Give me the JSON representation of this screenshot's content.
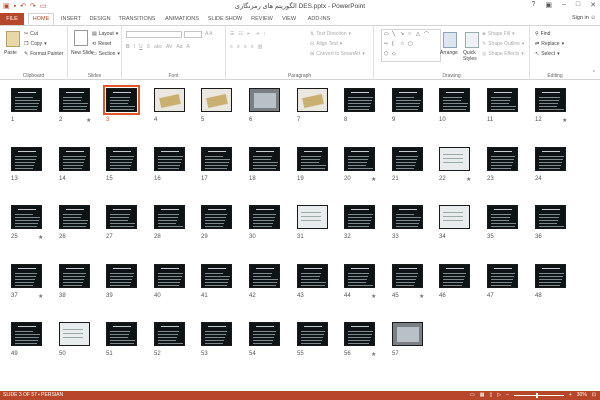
{
  "window": {
    "title": "DES.pptx - PowerPoint",
    "title_rtl": "الگوریتم های رمزنگاری",
    "signin": "Sign in"
  },
  "tabs": [
    "FILE",
    "HOME",
    "INSERT",
    "DESIGN",
    "TRANSITIONS",
    "ANIMATIONS",
    "SLIDE SHOW",
    "REVIEW",
    "VIEW",
    "ADD-INS"
  ],
  "ribbon": {
    "clipboard": {
      "paste": "Paste",
      "cut": "Cut",
      "copy": "Copy",
      "format_painter": "Format Painter",
      "label": "Clipboard"
    },
    "slides": {
      "new_slide": "New Slide",
      "layout": "Layout",
      "reset": "Reset",
      "section": "Section",
      "label": "Slides"
    },
    "font": {
      "label": "Font"
    },
    "paragraph": {
      "text_direction": "Text Direction",
      "align_text": "Align Text",
      "convert_smartart": "Convert to SmartArt",
      "label": "Paragraph"
    },
    "drawing": {
      "arrange": "Arrange",
      "quick_styles": "Quick Styles",
      "shape_fill": "Shape Fill",
      "shape_outline": "Shape Outline",
      "shape_effects": "Shape Effects",
      "label": "Drawing"
    },
    "editing": {
      "find": "Find",
      "replace": "Replace",
      "select": "Select",
      "label": "Editing"
    }
  },
  "slides": [
    {
      "n": "1",
      "star": false,
      "kind": "title"
    },
    {
      "n": "2",
      "star": true,
      "kind": "dark"
    },
    {
      "n": "3",
      "star": false,
      "kind": "dark",
      "selected": true
    },
    {
      "n": "4",
      "star": false,
      "kind": "diagram"
    },
    {
      "n": "5",
      "star": false,
      "kind": "diagram2"
    },
    {
      "n": "6",
      "star": false,
      "kind": "photo"
    },
    {
      "n": "7",
      "star": false,
      "kind": "diagram3"
    },
    {
      "n": "8",
      "star": false,
      "kind": "dark"
    },
    {
      "n": "9",
      "star": false,
      "kind": "dark"
    },
    {
      "n": "10",
      "star": false,
      "kind": "dark"
    },
    {
      "n": "11",
      "star": false,
      "kind": "dark"
    },
    {
      "n": "12",
      "star": true,
      "kind": "dark"
    },
    {
      "n": "13",
      "star": false,
      "kind": "dark"
    },
    {
      "n": "14",
      "star": false,
      "kind": "dark"
    },
    {
      "n": "15",
      "star": false,
      "kind": "dark"
    },
    {
      "n": "16",
      "star": false,
      "kind": "dark"
    },
    {
      "n": "17",
      "star": false,
      "kind": "dark"
    },
    {
      "n": "18",
      "star": false,
      "kind": "dark"
    },
    {
      "n": "19",
      "star": false,
      "kind": "dark"
    },
    {
      "n": "20",
      "star": true,
      "kind": "dark"
    },
    {
      "n": "21",
      "star": false,
      "kind": "dark"
    },
    {
      "n": "22",
      "star": true,
      "kind": "light"
    },
    {
      "n": "23",
      "star": false,
      "kind": "dark"
    },
    {
      "n": "24",
      "star": false,
      "kind": "dark"
    },
    {
      "n": "25",
      "star": true,
      "kind": "dark"
    },
    {
      "n": "26",
      "star": false,
      "kind": "dark"
    },
    {
      "n": "27",
      "star": false,
      "kind": "dark"
    },
    {
      "n": "28",
      "star": false,
      "kind": "dark"
    },
    {
      "n": "29",
      "star": false,
      "kind": "dark"
    },
    {
      "n": "30",
      "star": false,
      "kind": "dark"
    },
    {
      "n": "31",
      "star": false,
      "kind": "light"
    },
    {
      "n": "32",
      "star": false,
      "kind": "dark"
    },
    {
      "n": "33",
      "star": false,
      "kind": "dark"
    },
    {
      "n": "34",
      "star": false,
      "kind": "light"
    },
    {
      "n": "35",
      "star": false,
      "kind": "dark"
    },
    {
      "n": "36",
      "star": false,
      "kind": "dark"
    },
    {
      "n": "37",
      "star": true,
      "kind": "dark"
    },
    {
      "n": "38",
      "star": false,
      "kind": "dark"
    },
    {
      "n": "39",
      "star": false,
      "kind": "dark"
    },
    {
      "n": "40",
      "star": false,
      "kind": "dark"
    },
    {
      "n": "41",
      "star": false,
      "kind": "dark"
    },
    {
      "n": "42",
      "star": false,
      "kind": "dark"
    },
    {
      "n": "43",
      "star": false,
      "kind": "dark"
    },
    {
      "n": "44",
      "star": true,
      "kind": "dark"
    },
    {
      "n": "45",
      "star": true,
      "kind": "dark"
    },
    {
      "n": "46",
      "star": false,
      "kind": "dark"
    },
    {
      "n": "47",
      "star": false,
      "kind": "dark"
    },
    {
      "n": "48",
      "star": false,
      "kind": "dark"
    },
    {
      "n": "49",
      "star": false,
      "kind": "dark"
    },
    {
      "n": "50",
      "star": false,
      "kind": "light"
    },
    {
      "n": "51",
      "star": false,
      "kind": "dark"
    },
    {
      "n": "52",
      "star": false,
      "kind": "dark"
    },
    {
      "n": "53",
      "star": false,
      "kind": "dark"
    },
    {
      "n": "54",
      "star": false,
      "kind": "dark"
    },
    {
      "n": "55",
      "star": false,
      "kind": "dark"
    },
    {
      "n": "56",
      "star": true,
      "kind": "dark"
    },
    {
      "n": "57",
      "star": false,
      "kind": "photo"
    }
  ],
  "status": {
    "slide_of": "SLIDE 3 OF 57",
    "language": "PERSIAN",
    "zoom": "30%"
  },
  "colors": {
    "accent": "#b7472a",
    "selection": "#e1562b",
    "slide_bg": "#0e1316"
  }
}
